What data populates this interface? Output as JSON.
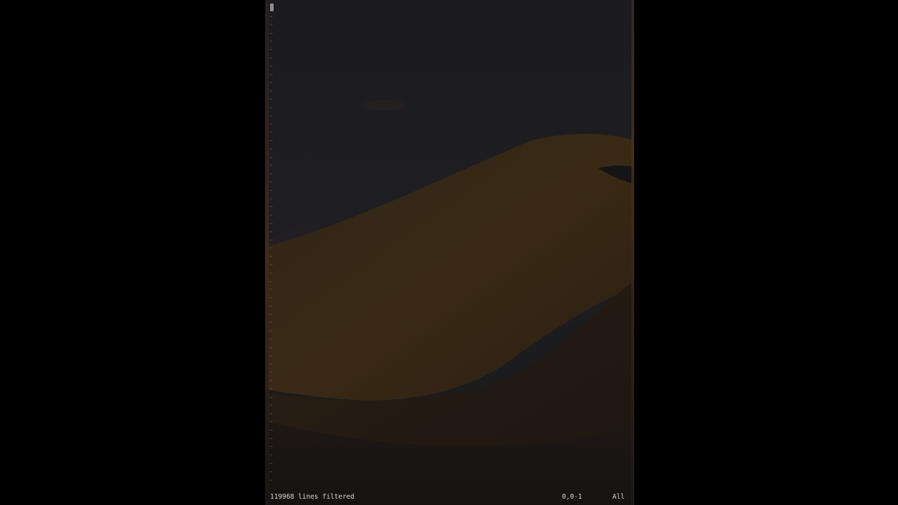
{
  "editor": {
    "empty_line_marker": "~",
    "empty_line_count": 57
  },
  "statusline": {
    "message": "119968 lines filtered",
    "cursor_position": "0,0-1",
    "scroll_position": "All"
  },
  "colors": {
    "background": "#000000",
    "terminal_bg": "#1d1c1e",
    "tilde": "#4a4a8a",
    "status_text": "#d8d8d8",
    "dune": "#3b2a14"
  }
}
